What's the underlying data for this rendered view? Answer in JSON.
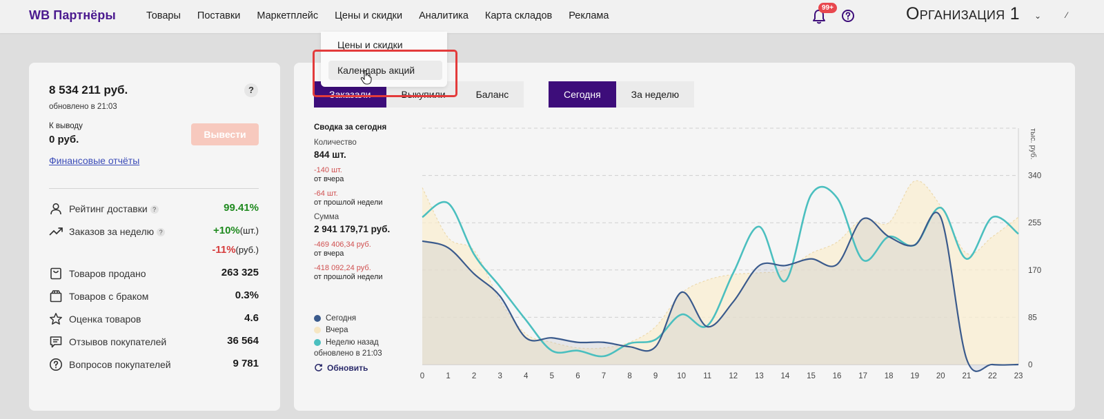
{
  "header": {
    "brand": "WB Партнёры",
    "nav": [
      "Товары",
      "Поставки",
      "Маркетплейс",
      "Цены и скидки",
      "Аналитика",
      "Карта складов",
      "Реклама"
    ],
    "notifications_badge": "99+",
    "organization": "Организация 1"
  },
  "dropdown": {
    "items": [
      "Цены и скидки",
      "Календарь акций"
    ]
  },
  "finance": {
    "balance": "8 534 211 руб.",
    "updated": "обновлено в 21:03",
    "help": "?",
    "to_withdraw_label": "К выводу",
    "to_withdraw_value": "0 руб.",
    "withdraw_button": "Вывести",
    "reports_link": "Финансовые отчёты"
  },
  "stats": [
    {
      "label": "Рейтинг доставки",
      "value": "99.41%",
      "help": "?"
    },
    {
      "label": "Заказов за неделю",
      "value": "+10%",
      "unit": "(шт.)",
      "value2": "-11%",
      "unit2": "(руб.)",
      "help": "?"
    },
    {
      "label": "Товаров продано",
      "value": "263 325"
    },
    {
      "label": "Товаров с браком",
      "value": "0.3%"
    },
    {
      "label": "Оценка товаров",
      "value": "4.6"
    },
    {
      "label": "Отзывов покупателей",
      "value": "36 564"
    },
    {
      "label": "Вопросов покупателей",
      "value": "9 781"
    }
  ],
  "tabs": {
    "metric": [
      "Заказали",
      "Выкупили",
      "Баланс"
    ],
    "metric_active": 0,
    "period": [
      "Сегодня",
      "За неделю"
    ],
    "period_active": 0
  },
  "summary": {
    "title": "Сводка за сегодня",
    "qty_label": "Количество",
    "qty_value": "844 шт.",
    "qty_vs_yesterday": "-140 шт.",
    "vs_yesterday_label": "от вчера",
    "qty_vs_week": "-64 шт.",
    "vs_week_label": "от прошлой недели",
    "sum_label": "Сумма",
    "sum_value": "2 941 179,71 руб.",
    "sum_vs_yesterday": "-469 406,34 руб.",
    "sum_vs_week": "-418 092,24 руб."
  },
  "legend": {
    "updated": "обновлено в 21:03",
    "refresh": "Обновить"
  },
  "colors": {
    "accent": "#3d0d7a",
    "brand": "#4b1a8f",
    "today": "#3a5a8c",
    "yesterday": "#f6e6c3",
    "week_ago": "#4bbfbf",
    "negative": "#d05050"
  },
  "chart_data": {
    "type": "line",
    "x": [
      0,
      1,
      2,
      3,
      4,
      5,
      6,
      7,
      8,
      9,
      10,
      11,
      12,
      13,
      14,
      15,
      16,
      17,
      18,
      19,
      20,
      21,
      22,
      23
    ],
    "ylabel": "тыс. руб.",
    "yticks": [
      0,
      85,
      170,
      255,
      340
    ],
    "ylim": [
      0,
      425
    ],
    "grid": true,
    "series": [
      {
        "name": "Сегодня",
        "color": "#3a5a8c",
        "values": [
          222,
          210,
          163,
          123,
          48,
          48,
          40,
          40,
          32,
          32,
          130,
          68,
          113,
          178,
          178,
          190,
          180,
          262,
          230,
          215,
          265,
          10,
          0,
          0
        ]
      },
      {
        "name": "Вчера",
        "color": "#f6e6c3",
        "values": [
          318,
          228,
          205,
          115,
          55,
          40,
          30,
          30,
          40,
          68,
          128,
          152,
          162,
          165,
          170,
          200,
          220,
          262,
          255,
          330,
          285,
          200,
          230,
          265
        ]
      },
      {
        "name": "Неделю назад",
        "color": "#4bbfbf",
        "values": [
          265,
          290,
          198,
          140,
          80,
          25,
          25,
          15,
          38,
          45,
          90,
          70,
          165,
          248,
          150,
          305,
          300,
          188,
          230,
          215,
          282,
          190,
          265,
          235
        ]
      }
    ]
  }
}
